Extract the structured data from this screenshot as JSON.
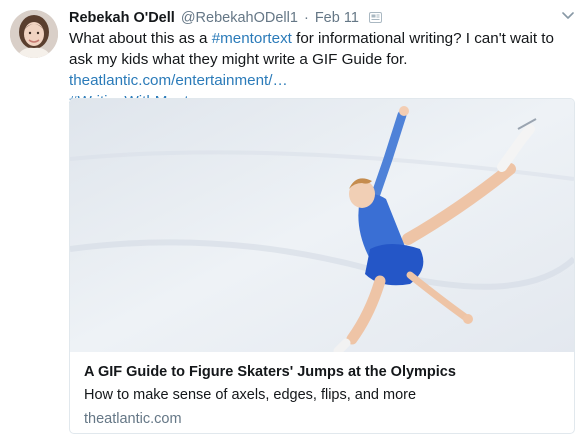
{
  "tweet": {
    "author_name": "Rebekah O'Dell",
    "handle": "@RebekahODell1",
    "separator": "·",
    "timestamp": "Feb 11",
    "text_parts": {
      "p1": "What about this as a ",
      "tag1": "#mentortext",
      "p2": " for informational writing? I can't wait to ask my kids what they might write a GIF Guide for. ",
      "url": "theatlantic.com/entertainment/…",
      "tag2": "#WritingWithMentors"
    }
  },
  "card": {
    "title": "A GIF Guide to Figure Skaters' Jumps at the Olympics",
    "description": "How to make sense of axels, edges, flips, and more",
    "domain": "theatlantic.com"
  },
  "icons": {
    "verified": "card-icon",
    "menu": "chevron-down-icon"
  },
  "colors": {
    "link": "#2b7bb9",
    "secondary_text": "#657786",
    "border": "#e1e8ed"
  }
}
